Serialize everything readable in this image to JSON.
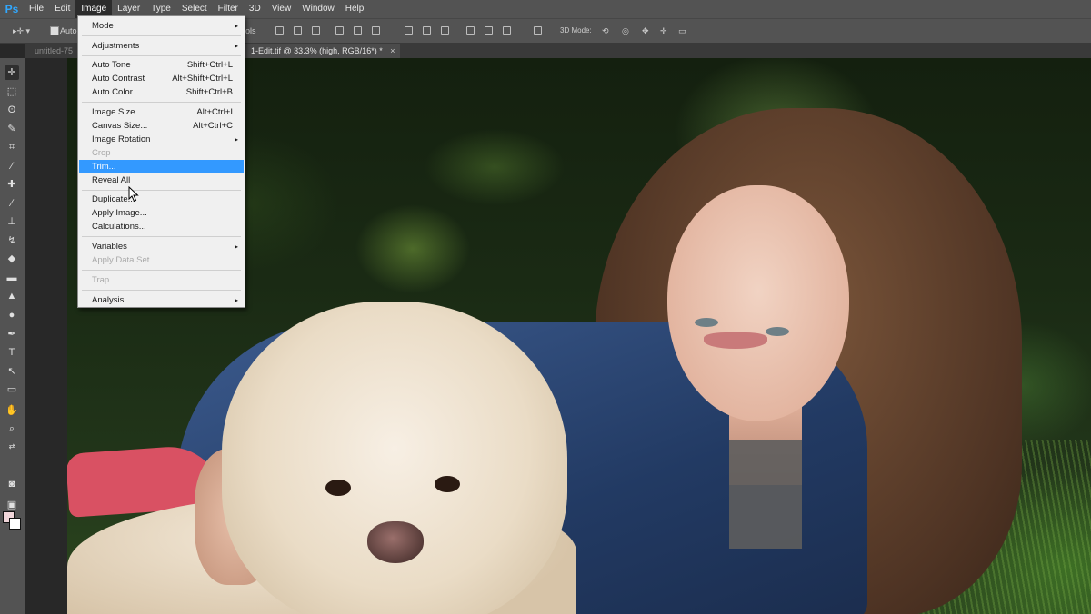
{
  "app": {
    "logo": "Ps"
  },
  "menubar": {
    "items": [
      {
        "label": "File"
      },
      {
        "label": "Edit"
      },
      {
        "label": "Image"
      },
      {
        "label": "Layer"
      },
      {
        "label": "Type"
      },
      {
        "label": "Select"
      },
      {
        "label": "Filter"
      },
      {
        "label": "3D"
      },
      {
        "label": "View"
      },
      {
        "label": "Window"
      },
      {
        "label": "Help"
      }
    ]
  },
  "options": {
    "auto_label": "Auto-",
    "ols_label": "ols",
    "mode_3d": "3D Mode:"
  },
  "tabs": [
    {
      "label": "untitled-75"
    },
    {
      "label": "1-Edit.tif @ 33.3% (high, RGB/16*) *",
      "close": "×"
    }
  ],
  "colors": {
    "accent": "#3399ff",
    "foreground": "#f1d6da",
    "background": "#ffffff"
  },
  "image_menu": {
    "items": [
      {
        "label": "Mode",
        "shortcut": "",
        "submenu": true,
        "disabled": false
      },
      {
        "label": "Adjustments",
        "shortcut": "",
        "submenu": true,
        "disabled": false
      },
      {
        "label": "Auto Tone",
        "shortcut": "Shift+Ctrl+L",
        "submenu": false,
        "disabled": false
      },
      {
        "label": "Auto Contrast",
        "shortcut": "Alt+Shift+Ctrl+L",
        "submenu": false,
        "disabled": false
      },
      {
        "label": "Auto Color",
        "shortcut": "Shift+Ctrl+B",
        "submenu": false,
        "disabled": false
      },
      {
        "label": "Image Size...",
        "shortcut": "Alt+Ctrl+I",
        "submenu": false,
        "disabled": false
      },
      {
        "label": "Canvas Size...",
        "shortcut": "Alt+Ctrl+C",
        "submenu": false,
        "disabled": false
      },
      {
        "label": "Image Rotation",
        "shortcut": "",
        "submenu": true,
        "disabled": false
      },
      {
        "label": "Crop",
        "shortcut": "",
        "submenu": false,
        "disabled": true
      },
      {
        "label": "Trim...",
        "shortcut": "",
        "submenu": false,
        "disabled": false,
        "highlighted": true
      },
      {
        "label": "Reveal All",
        "shortcut": "",
        "submenu": false,
        "disabled": false
      },
      {
        "label": "Duplicate...",
        "shortcut": "",
        "submenu": false,
        "disabled": false
      },
      {
        "label": "Apply Image...",
        "shortcut": "",
        "submenu": false,
        "disabled": false
      },
      {
        "label": "Calculations...",
        "shortcut": "",
        "submenu": false,
        "disabled": false
      },
      {
        "label": "Variables",
        "shortcut": "",
        "submenu": true,
        "disabled": false
      },
      {
        "label": "Apply Data Set...",
        "shortcut": "",
        "submenu": false,
        "disabled": true
      },
      {
        "label": "Trap...",
        "shortcut": "",
        "submenu": false,
        "disabled": true
      },
      {
        "label": "Analysis",
        "shortcut": "",
        "submenu": true,
        "disabled": false
      }
    ],
    "submenu_arrow": "▸"
  }
}
